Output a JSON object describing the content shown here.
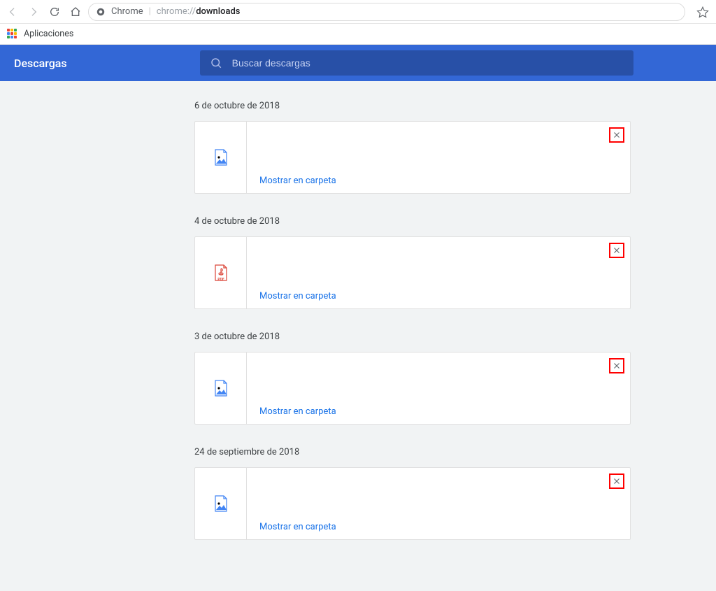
{
  "omnibox": {
    "page_label": "Chrome",
    "url_prefix": "chrome://",
    "url_path": "downloads"
  },
  "bookmarks": {
    "apps_label": "Aplicaciones"
  },
  "header": {
    "title": "Descargas",
    "search_placeholder": "Buscar descargas"
  },
  "link_labels": {
    "show_in_folder": "Mostrar en carpeta"
  },
  "groups": [
    {
      "date": "6 de octubre de 2018",
      "items": [
        {
          "type": "image"
        }
      ]
    },
    {
      "date": "4 de octubre de 2018",
      "items": [
        {
          "type": "pdf"
        }
      ]
    },
    {
      "date": "3 de octubre de 2018",
      "items": [
        {
          "type": "image"
        }
      ]
    },
    {
      "date": "24 de septiembre de 2018",
      "items": [
        {
          "type": "image"
        }
      ]
    }
  ]
}
